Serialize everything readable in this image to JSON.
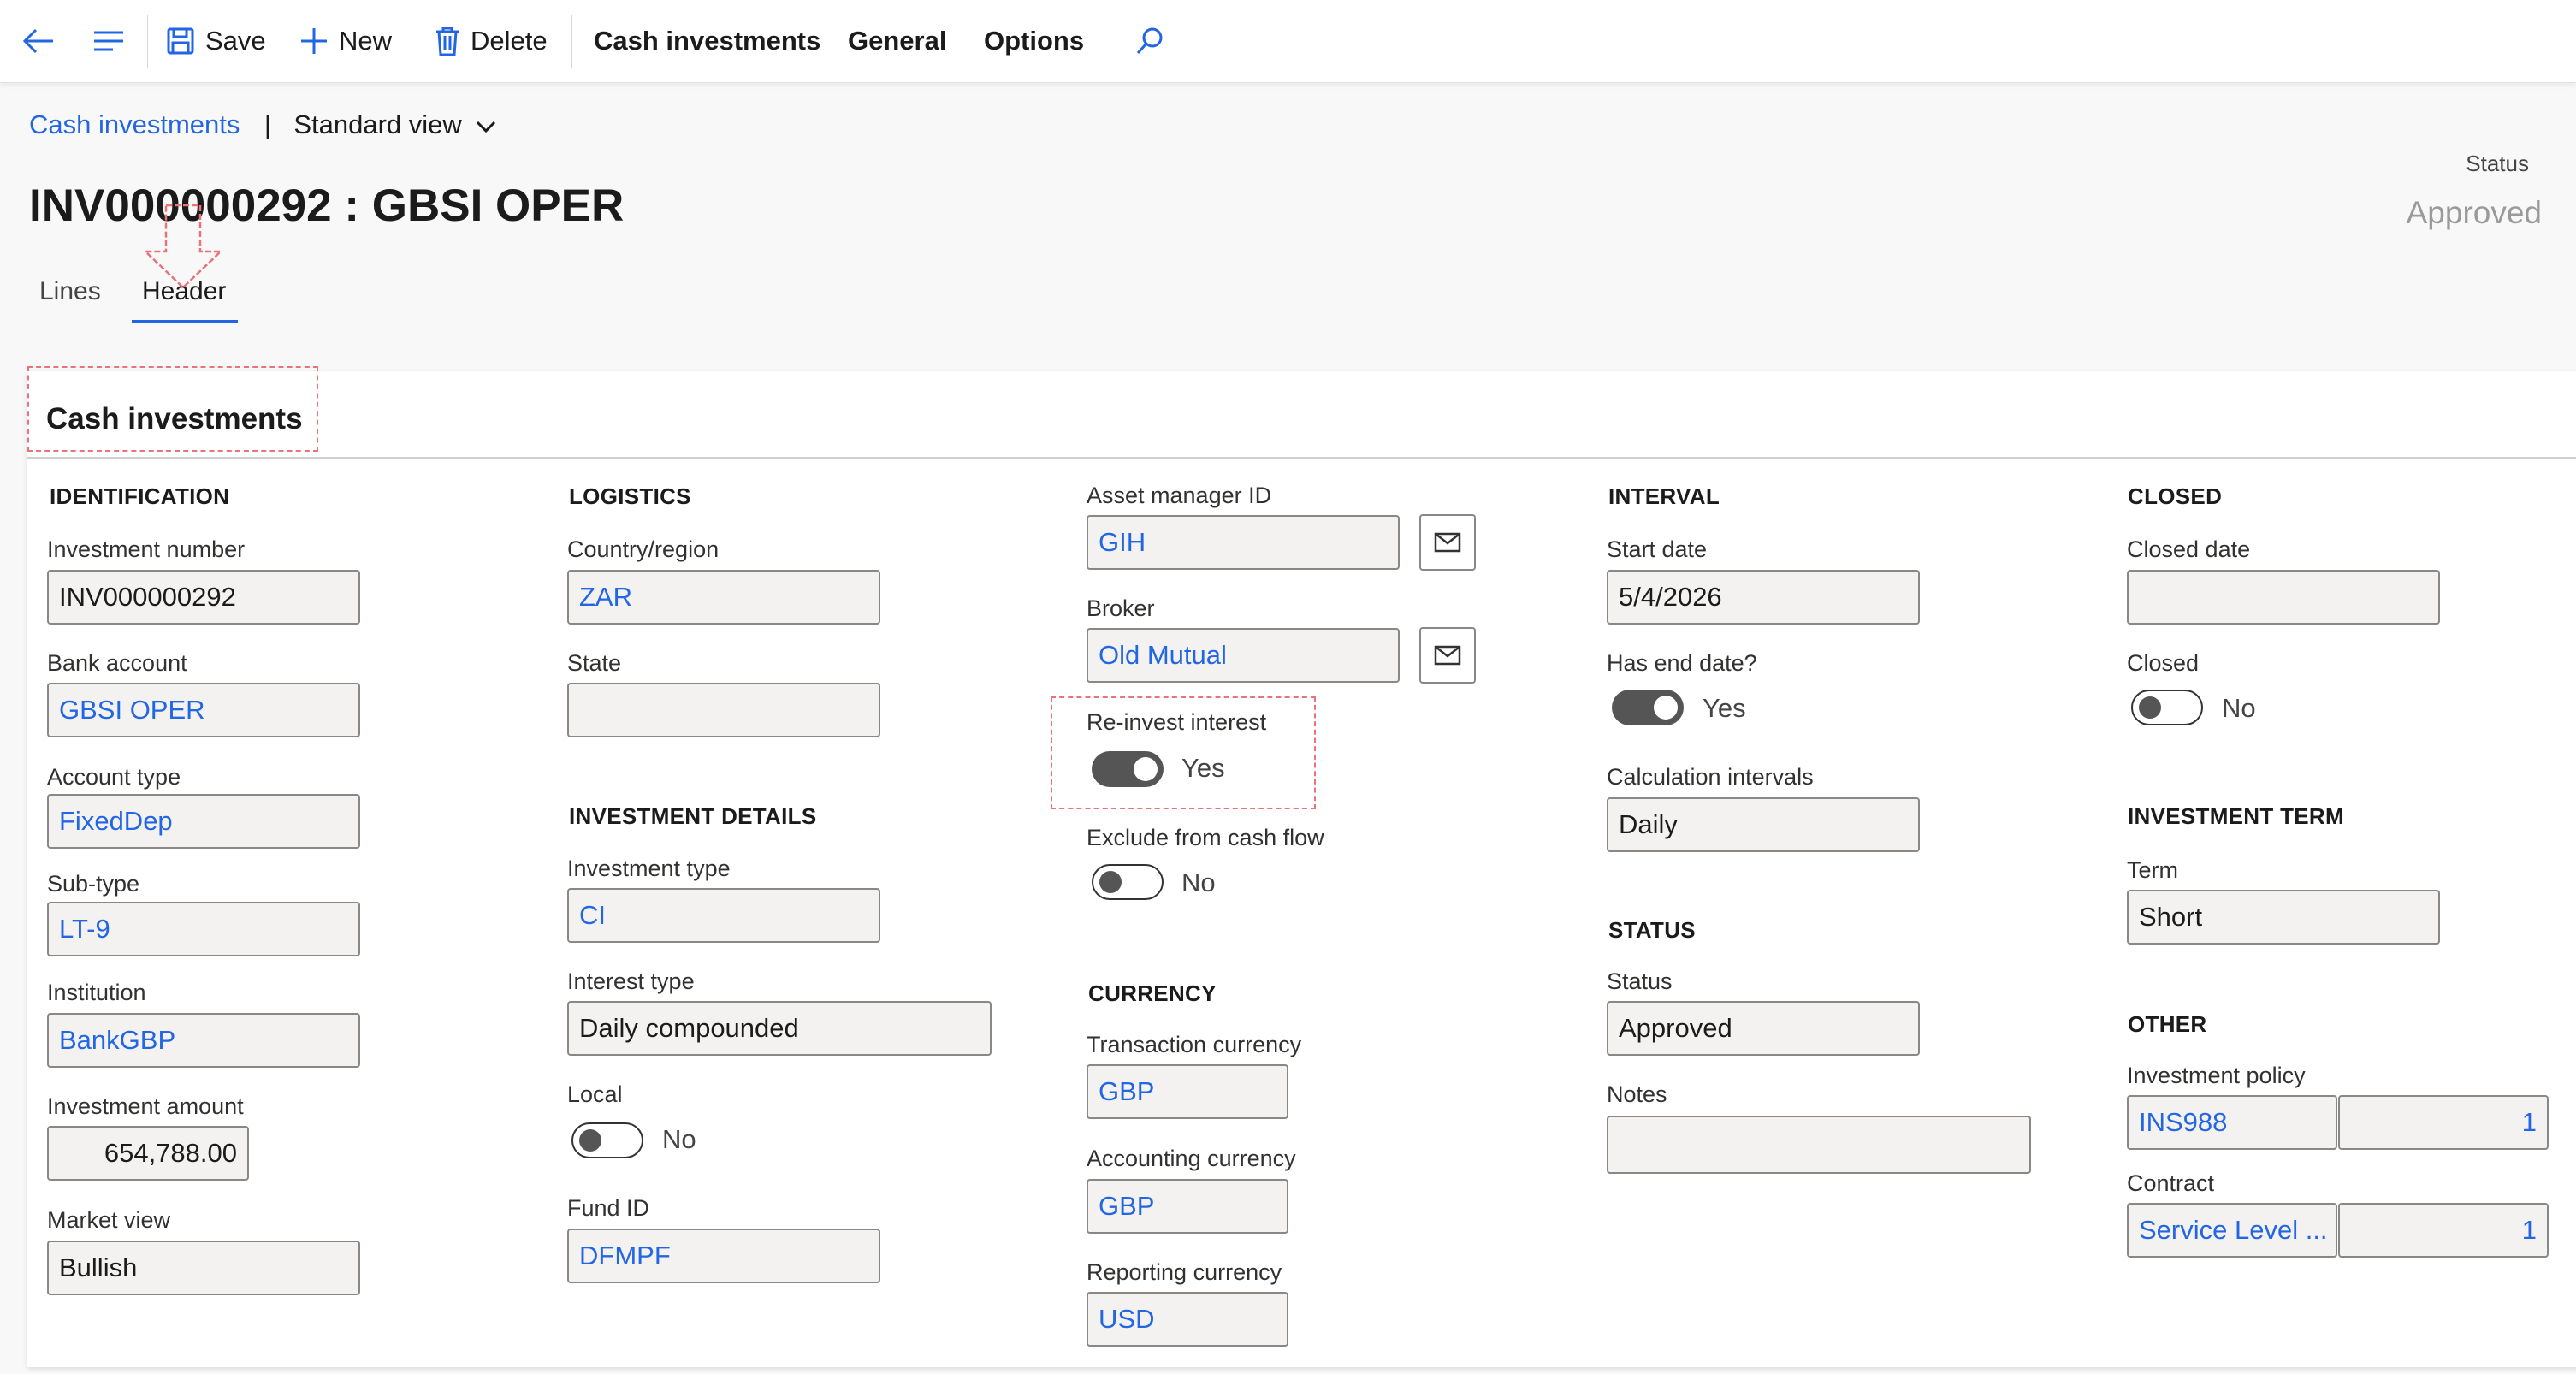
{
  "toolbar": {
    "save": "Save",
    "new": "New",
    "delete": "Delete",
    "menu_cash": "Cash investments",
    "menu_general": "General",
    "menu_options": "Options",
    "icons": [
      "back-arrow-icon",
      "hamburger-icon",
      "save-icon",
      "plus-icon",
      "trash-icon",
      "search-icon"
    ]
  },
  "breadcrumb": {
    "link": "Cash investments",
    "separator": "|",
    "view": "Standard view"
  },
  "page": {
    "title": "INV000000292 : GBSI OPER",
    "status_label": "Status",
    "status_value": "Approved"
  },
  "tabs": [
    {
      "label": "Lines"
    },
    {
      "label": "Header"
    }
  ],
  "card": {
    "title": "Cash investments",
    "identification": {
      "title": "IDENTIFICATION",
      "investment_number_label": "Investment number",
      "investment_number": "INV000000292",
      "bank_account_label": "Bank account",
      "bank_account": "GBSI OPER",
      "account_type_label": "Account type",
      "account_type": "FixedDep",
      "sub_type_label": "Sub-type",
      "sub_type": "LT-9",
      "institution_label": "Institution",
      "institution": "BankGBP",
      "investment_amount_label": "Investment amount",
      "investment_amount": "654,788.00",
      "market_view_label": "Market view",
      "market_view": "Bullish"
    },
    "logistics": {
      "title": "LOGISTICS",
      "country_label": "Country/region",
      "country": "ZAR",
      "state_label": "State",
      "state": ""
    },
    "investment_details": {
      "title": "INVESTMENT DETAILS",
      "investment_type_label": "Investment type",
      "investment_type": "CI",
      "interest_type_label": "Interest type",
      "interest_type": "Daily compounded",
      "local_label": "Local",
      "local": "No",
      "fund_id_label": "Fund ID",
      "fund_id": "DFMPF"
    },
    "manager": {
      "asset_manager_label": "Asset manager ID",
      "asset_manager": "GIH",
      "broker_label": "Broker",
      "broker": "Old Mutual",
      "reinvest_label": "Re-invest interest",
      "reinvest": "Yes",
      "exclude_label": "Exclude from cash flow",
      "exclude": "No"
    },
    "currency": {
      "title": "CURRENCY",
      "transaction_label": "Transaction currency",
      "transaction": "GBP",
      "accounting_label": "Accounting currency",
      "accounting": "GBP",
      "reporting_label": "Reporting currency",
      "reporting": "USD"
    },
    "interval": {
      "title": "INTERVAL",
      "start_date_label": "Start date",
      "start_date": "5/4/2026",
      "has_end_date_label": "Has end date?",
      "has_end_date": "Yes",
      "calc_intervals_label": "Calculation intervals",
      "calc_intervals": "Daily"
    },
    "status": {
      "title": "STATUS",
      "status_label": "Status",
      "status": "Approved",
      "notes_label": "Notes",
      "notes": ""
    },
    "closed": {
      "title": "CLOSED",
      "closed_date_label": "Closed date",
      "closed_date": "",
      "closed_label": "Closed",
      "closed": "No"
    },
    "investment_term": {
      "title": "INVESTMENT TERM",
      "term_label": "Term",
      "term": "Short"
    },
    "other": {
      "title": "OTHER",
      "policy_label": "Investment policy",
      "policy": "INS988",
      "policy_num": "1",
      "contract_label": "Contract",
      "contract": "Service Level ...",
      "contract_num": "1"
    }
  },
  "colors": {
    "link": "#2266e3",
    "annotation": "#e8737a",
    "toggle_on": "#555555"
  }
}
